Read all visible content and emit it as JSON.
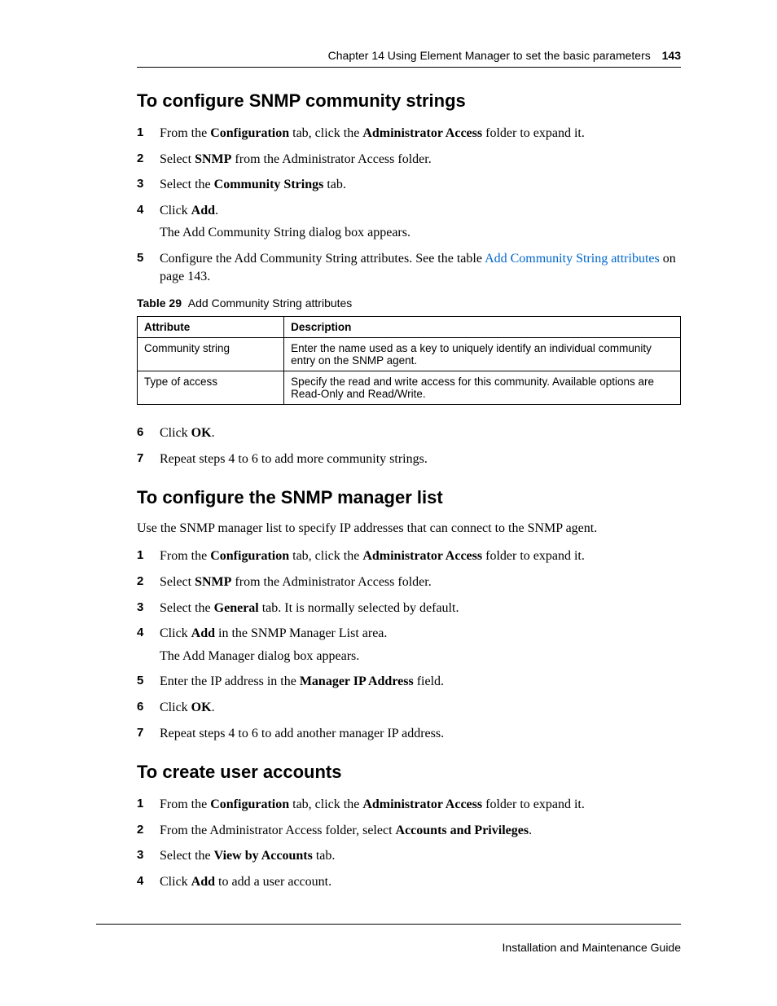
{
  "header": {
    "chapter": "Chapter 14  Using Element Manager to set the basic parameters",
    "page": "143"
  },
  "footer": {
    "guide": "Installation and Maintenance Guide"
  },
  "section1": {
    "title": "To configure SNMP community strings",
    "steps": {
      "s1_pre": "From the ",
      "s1_b1": "Configuration",
      "s1_mid": " tab, click the ",
      "s1_b2": "Administrator Access",
      "s1_post": " folder to expand it.",
      "s2_pre": "Select ",
      "s2_b1": "SNMP",
      "s2_post": " from the Administrator Access folder.",
      "s3_pre": "Select the ",
      "s3_b1": "Community Strings",
      "s3_post": " tab.",
      "s4_pre": "Click ",
      "s4_b1": "Add",
      "s4_post": ".",
      "s4_sub": "The Add Community String dialog box appears.",
      "s5_pre": "Configure the Add Community String attributes. See the table ",
      "s5_link": "Add Community String attributes",
      "s5_post": " on page 143.",
      "s6_pre": "Click ",
      "s6_b1": "OK",
      "s6_post": ".",
      "s7": "Repeat steps 4 to 6 to add more community strings."
    }
  },
  "table29": {
    "label": "Table 29",
    "title": "Add Community String attributes",
    "h1": "Attribute",
    "h2": "Description",
    "r1c1": "Community string",
    "r1c2": "Enter the name used as a key to uniquely identify an individual community entry on the SNMP agent.",
    "r2c1": "Type of access",
    "r2c2": "Specify the read and write access for this community. Available options are Read-Only and Read/Write."
  },
  "section2": {
    "title": "To configure the SNMP manager list",
    "intro": "Use the SNMP manager list to specify IP addresses that can connect to the SNMP agent.",
    "steps": {
      "s1_pre": "From the ",
      "s1_b1": "Configuration",
      "s1_mid": " tab, click the ",
      "s1_b2": "Administrator Access",
      "s1_post": " folder to expand it.",
      "s2_pre": "Select ",
      "s2_b1": "SNMP",
      "s2_post": " from the Administrator Access folder.",
      "s3_pre": "Select the ",
      "s3_b1": "General",
      "s3_post": " tab. It is normally selected by default.",
      "s4_pre": "Click ",
      "s4_b1": "Add",
      "s4_post": " in the SNMP Manager List area.",
      "s4_sub": "The Add Manager dialog box appears.",
      "s5_pre": "Enter the IP address in the ",
      "s5_b1": "Manager IP Address",
      "s5_post": " field.",
      "s6_pre": "Click ",
      "s6_b1": "OK",
      "s6_post": ".",
      "s7": "Repeat steps 4 to 6 to add another manager IP address."
    }
  },
  "section3": {
    "title": "To create user accounts",
    "steps": {
      "s1_pre": "From the ",
      "s1_b1": "Configuration",
      "s1_mid": " tab, click the ",
      "s1_b2": "Administrator Access",
      "s1_post": " folder to expand it.",
      "s2_pre": "From the Administrator Access folder, select ",
      "s2_b1": "Accounts and Privileges",
      "s2_post": ".",
      "s3_pre": "Select the ",
      "s3_b1": "View by Accounts",
      "s3_post": " tab.",
      "s4_pre": "Click ",
      "s4_b1": "Add",
      "s4_post": " to add a user account."
    }
  },
  "nums": {
    "n1": "1",
    "n2": "2",
    "n3": "3",
    "n4": "4",
    "n5": "5",
    "n6": "6",
    "n7": "7"
  }
}
